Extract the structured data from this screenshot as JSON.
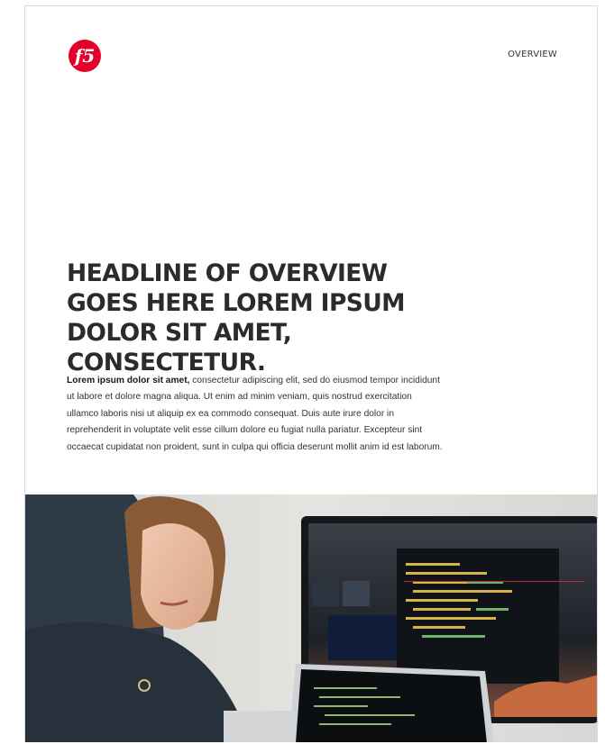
{
  "brand": {
    "logo_text": "f5",
    "accent": "#e4002b"
  },
  "header": {
    "section_label": "OVERVIEW"
  },
  "headline": "HEADLINE OF OVERVIEW GOES HERE LOREM IPSUM DOLOR SIT AMET, CONSECTETUR.",
  "body": {
    "lead": "Lorem ipsum dolor sit amet,",
    "text": "consectetur adipiscing elit, sed do eiusmod tempor incididunt ut labore et dolore magna aliqua. Ut enim ad minim veniam, quis nostrud exercitation ullamco laboris nisi ut aliquip ex ea commodo consequat. Duis aute irure dolor in reprehenderit in voluptate velit esse cillum dolore eu fugiat nulla pariatur. Excepteur sint occaecat cupidatat non proident, sunt in culpa qui officia deserunt mollit anim id est laborum."
  }
}
